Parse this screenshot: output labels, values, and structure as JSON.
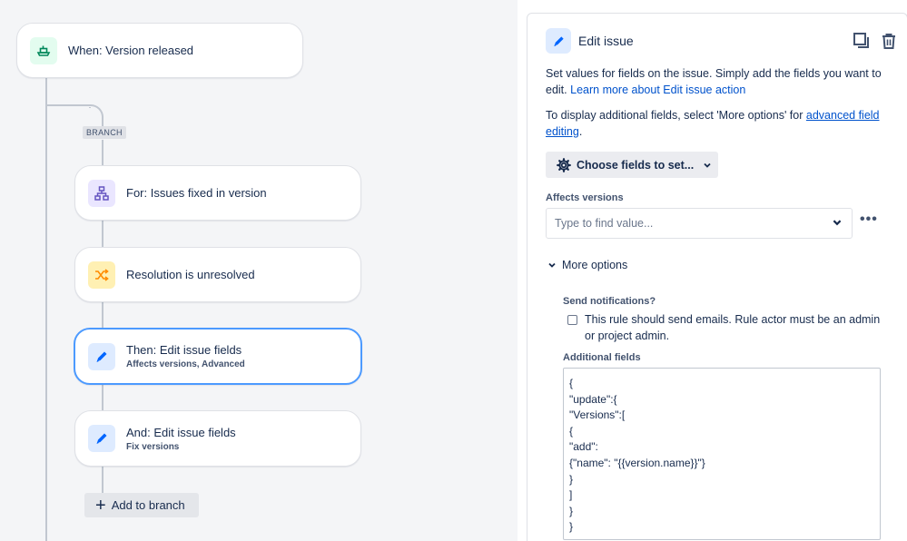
{
  "flow": {
    "trigger": {
      "title": "When: Version released"
    },
    "branch_tag": "BRANCH",
    "steps": [
      {
        "title": "For: Issues fixed in version",
        "subtitle": ""
      },
      {
        "title": "Resolution is unresolved",
        "subtitle": ""
      },
      {
        "title": "Then: Edit issue fields",
        "subtitle": "Affects versions, Advanced"
      },
      {
        "title": "And: Edit issue fields",
        "subtitle": "Fix versions"
      }
    ],
    "add_to_branch": "Add to branch"
  },
  "panel": {
    "title": "Edit issue",
    "description_1": "Set values for fields on the issue. Simply add the fields you want to edit.",
    "learn_more": "Learn more about Edit issue action",
    "description_2": "To display additional fields, select 'More options' for",
    "advanced_link": "advanced field editing",
    "period": ".",
    "choose_fields": "Choose fields to set...",
    "affects_versions_label": "Affects versions",
    "affects_versions_placeholder": "Type to find value...",
    "more_options": "More options",
    "send_notifications_label": "Send notifications?",
    "send_notifications_text": "This rule should send emails. Rule actor must be an admin or project admin.",
    "additional_fields_label": "Additional fields",
    "additional_fields_value": "{\n\"update\":{\n\"Versions\":[\n{\n\"add\":\n{\"name\": \"{{version.name}}\"}\n}\n]\n}\n}"
  },
  "colors": {
    "trigger_icon_bg": "#e3fcef",
    "trigger_icon": "#00875a",
    "branch_icon_bg": "#eae6ff",
    "branch_icon": "#6554c0",
    "condition_icon_bg": "#fff0b3",
    "condition_icon": "#ff8b00",
    "action_icon_bg": "#deebff",
    "action_icon": "#0065ff",
    "selected_border": "#4c9aff",
    "link": "#0052cc"
  },
  "icons": {
    "trigger": "ship-icon",
    "branch": "hierarchy-icon",
    "condition": "shuffle-icon",
    "action": "pencil-icon",
    "duplicate": "copy-icon",
    "delete": "trash-icon",
    "settings": "gear-icon"
  }
}
